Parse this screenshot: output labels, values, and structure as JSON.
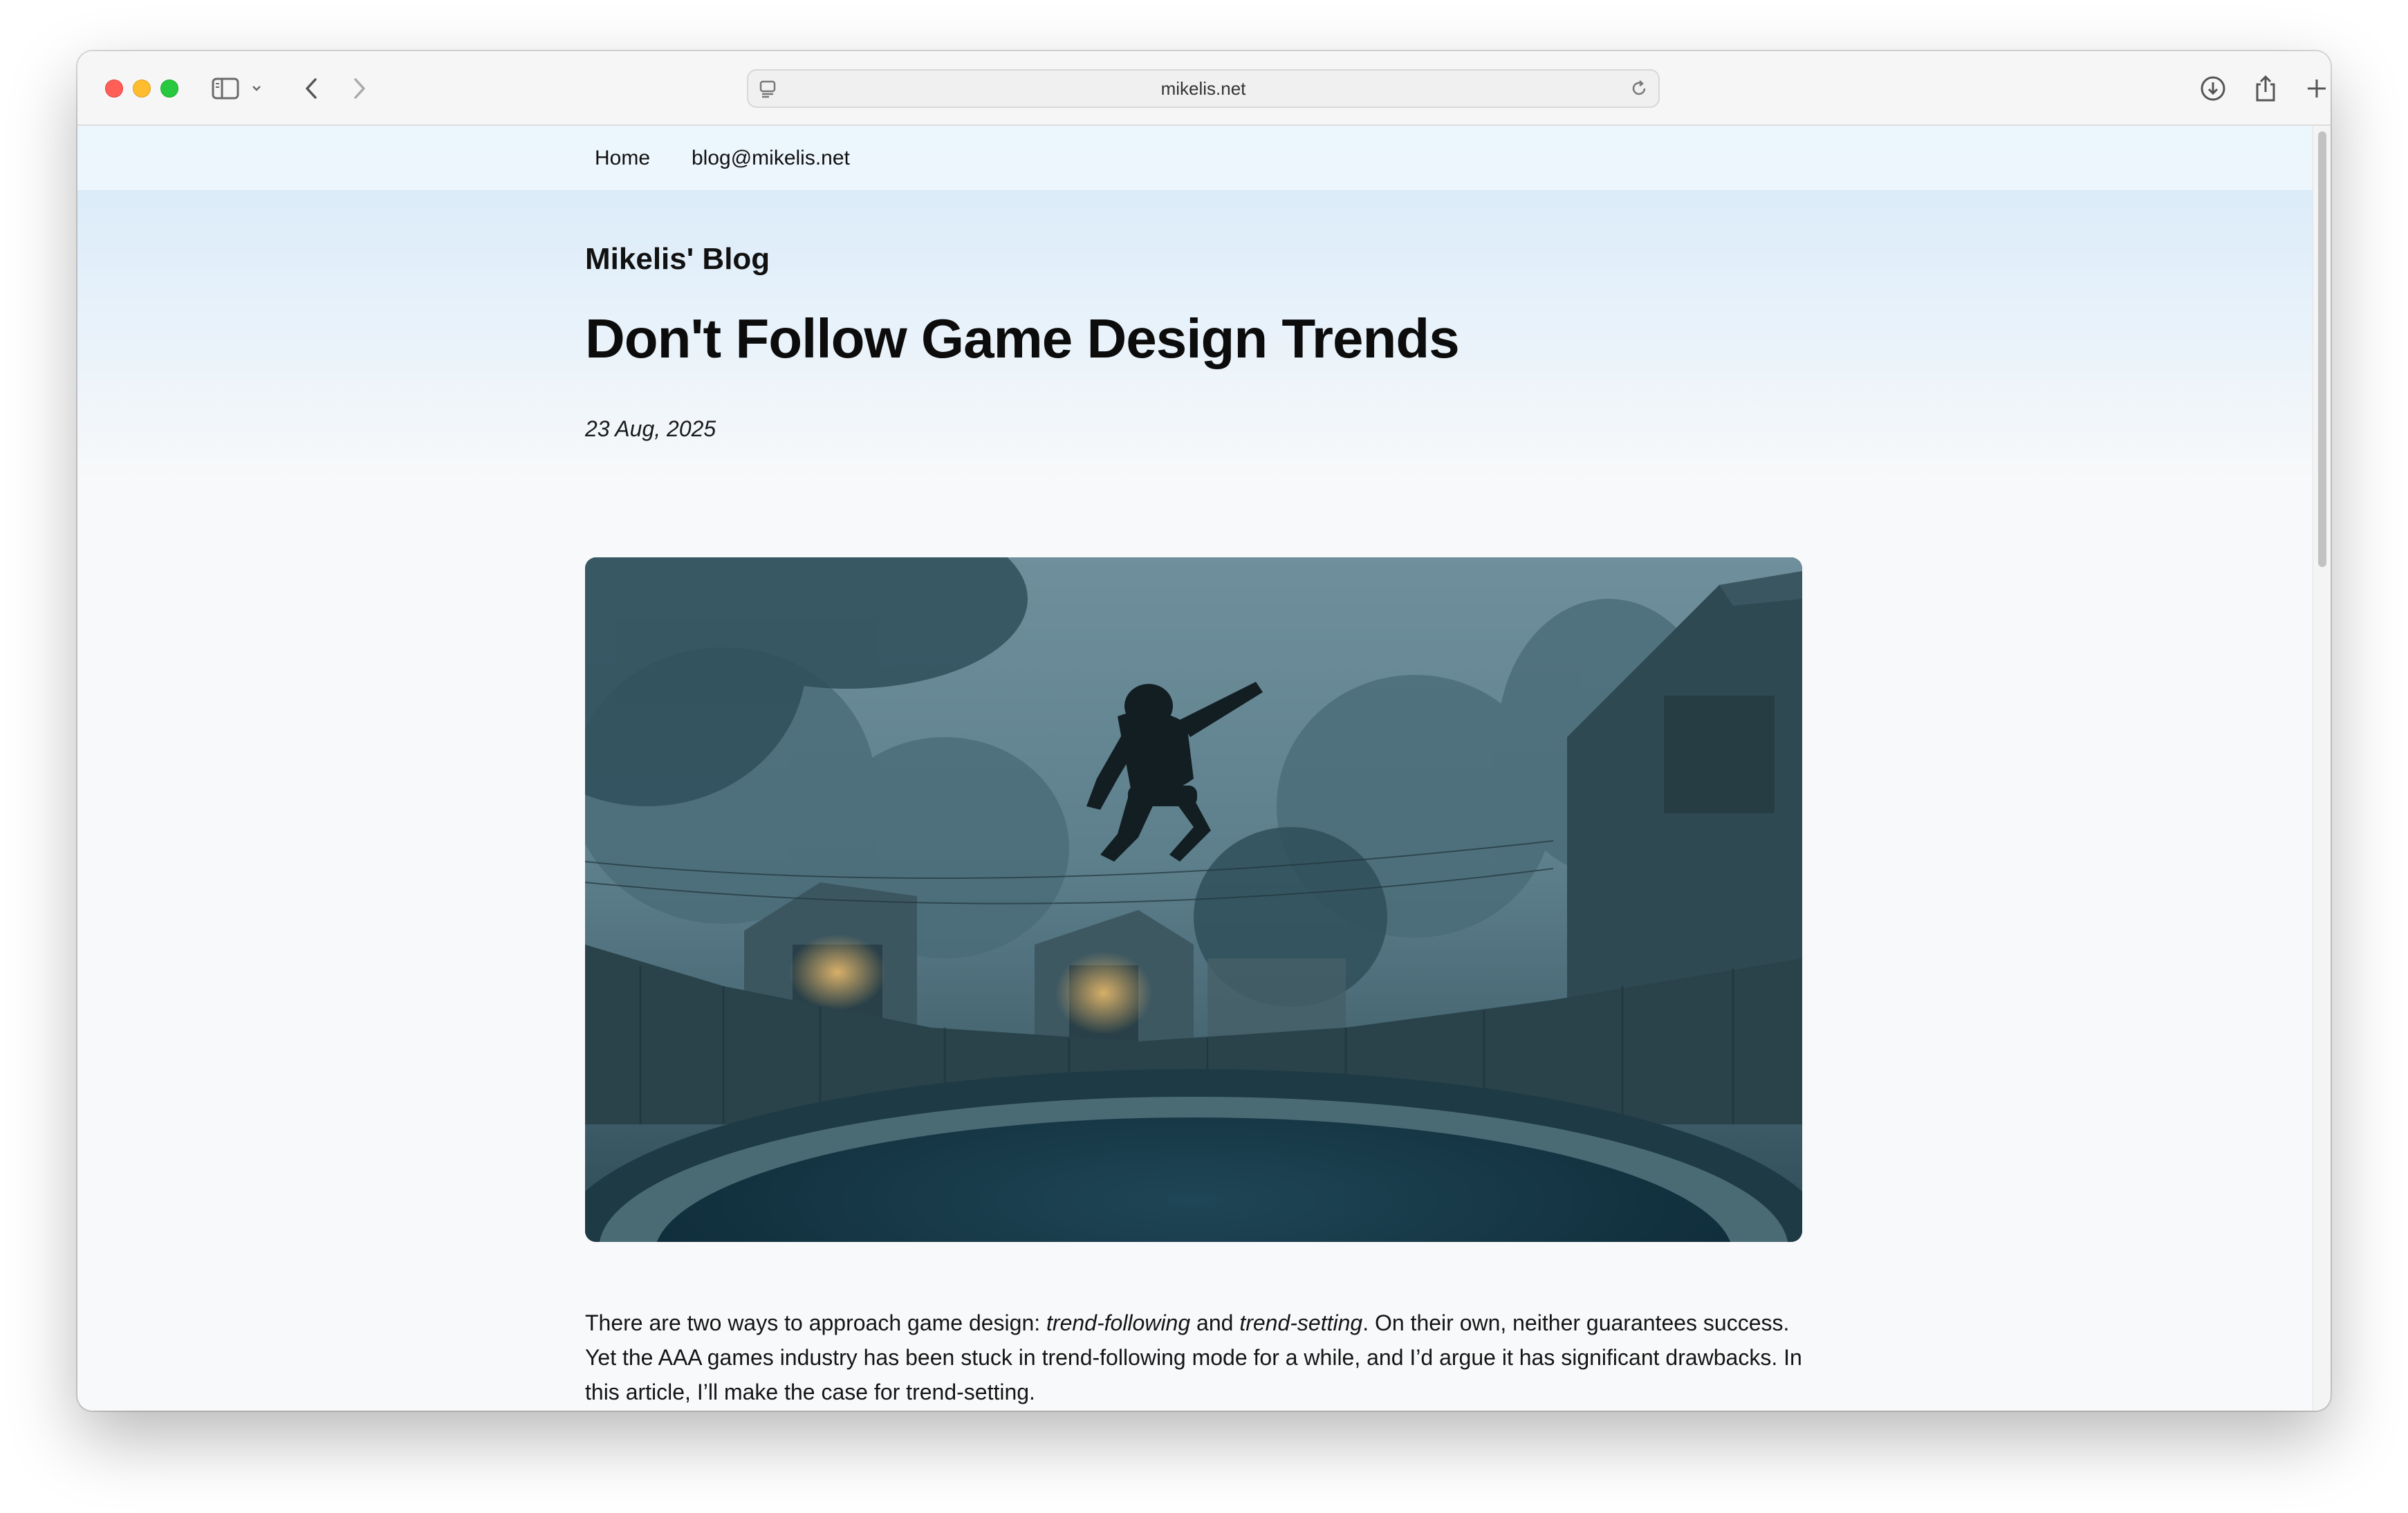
{
  "browser": {
    "url": "mikelis.net",
    "icons": [
      "sidebar-icon",
      "chevron-down-icon",
      "back-icon",
      "forward-icon",
      "reader-icon",
      "reload-icon",
      "download-icon",
      "share-icon",
      "new-tab-icon",
      "tab-overview-icon"
    ]
  },
  "nav": {
    "home": "Home",
    "email": "blog@mikelis.net"
  },
  "blog": {
    "name": "Mikelis' Blog"
  },
  "post": {
    "title": "Don't Follow Game Design Trends",
    "date": "23 Aug, 2025",
    "paragraph": {
      "part1": "There are two ways to approach game design: ",
      "em1": "trend-following",
      "part2": " and ",
      "em2": "trend-setting",
      "part3": ". On their own, neither guarantees success. Yet the AAA games industry has been stuck in trend-following mode for a while, and I’d argue it has significant drawbacks. In this article, I’ll make the case for trend-setting."
    }
  },
  "colors": {
    "accent_bg_top": "#d6e9f8",
    "page_bg": "#f8f9fa",
    "text": "#111111"
  }
}
